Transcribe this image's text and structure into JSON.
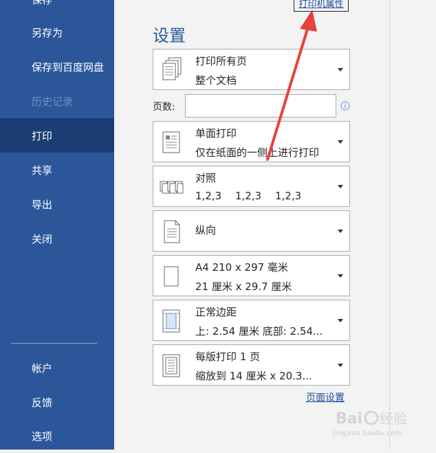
{
  "sidebar": {
    "items": [
      {
        "label": "保存",
        "state": "normal"
      },
      {
        "label": "另存为",
        "state": "normal"
      },
      {
        "label": "保存到百度网盘",
        "state": "normal"
      },
      {
        "label": "历史记录",
        "state": "disabled"
      },
      {
        "label": "打印",
        "state": "active"
      },
      {
        "label": "共享",
        "state": "normal"
      },
      {
        "label": "导出",
        "state": "normal"
      },
      {
        "label": "关闭",
        "state": "normal"
      }
    ],
    "bottom_items": [
      {
        "label": "帐户"
      },
      {
        "label": "反馈"
      },
      {
        "label": "选项"
      }
    ]
  },
  "main": {
    "printer_properties_link": "打印机属性",
    "settings_title": "设置",
    "page_range": {
      "line1": "打印所有页",
      "line2": "整个文档"
    },
    "pages_label": "页数:",
    "pages_value": "",
    "sides": {
      "line1": "单面打印",
      "line2": "仅在纸面的一侧上进行打印"
    },
    "collate": {
      "line1": "对照",
      "values": [
        "1,2,3",
        "1,2,3",
        "1,2,3"
      ]
    },
    "orientation": {
      "label": "纵向"
    },
    "paper_size": {
      "line1": "A4 210 x 297 毫米",
      "line2": "21 厘米 x 29.7 厘米"
    },
    "margins": {
      "line1": "正常边距",
      "line2": "上: 2.54 厘米 底部: 2.54..."
    },
    "pages_per_sheet": {
      "line1": "每版打印 1 页",
      "line2": "缩放到 14 厘米 x 20.3..."
    },
    "page_setup_link": "页面设置"
  },
  "watermark": {
    "text": "jingyan.baidu.com"
  },
  "colors": {
    "sidebar_bg": "#2b579a",
    "sidebar_active": "#1b3e72",
    "accent": "#2b579a",
    "link": "#1e4e9c",
    "arrow": "#e8413b"
  }
}
